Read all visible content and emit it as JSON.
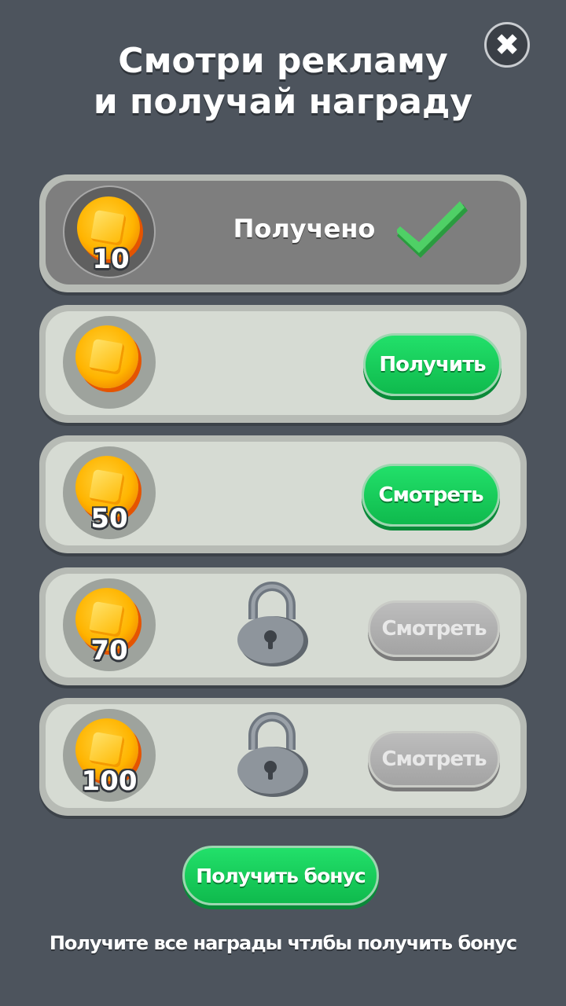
{
  "header": {
    "title_line1": "Смотри рекламу",
    "title_line2": "и получай награду",
    "close_icon": "close-icon"
  },
  "rewards": [
    {
      "amount": "10",
      "state": "claimed",
      "status_label": "Получено",
      "icon": "checkmark-icon"
    },
    {
      "amount": "",
      "state": "ready",
      "button_label": "Получить"
    },
    {
      "amount": "50",
      "state": "watch",
      "button_label": "Смотреть"
    },
    {
      "amount": "70",
      "state": "locked",
      "button_label": "Смотреть",
      "icon": "lock-icon"
    },
    {
      "amount": "100",
      "state": "locked",
      "button_label": "Смотреть",
      "icon": "lock-icon"
    }
  ],
  "bonus": {
    "button_label": "Получить бонус",
    "note": "Получите все награды чтлбы получить бонус"
  },
  "colors": {
    "background": "#4d545d",
    "accent_green": "#12c957",
    "coin": "#ffb400",
    "disabled": "#a8a8a8"
  }
}
